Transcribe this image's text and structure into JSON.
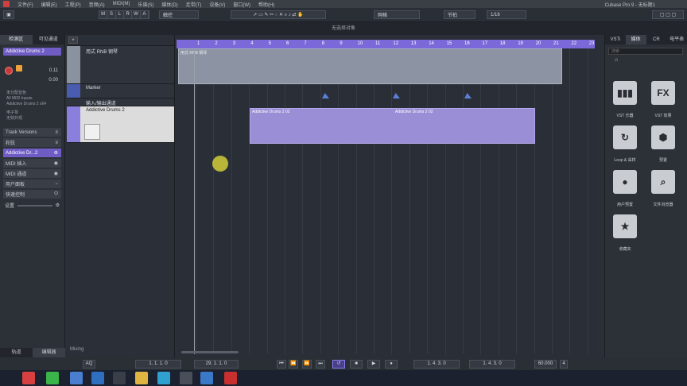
{
  "menubar": {
    "items": [
      "文件(F)",
      "编辑(E)",
      "工程(P)",
      "音频(A)",
      "MIDI(M)",
      "乐谱(S)",
      "媒体(D)",
      "走带(T)",
      "设备(V)",
      "窗口(W)",
      "帮助(H)"
    ],
    "app": "Cubase Pro 9 - 无标题1"
  },
  "toolbar": {
    "msrw": [
      "M",
      "S",
      "L",
      "R",
      "W",
      "A"
    ],
    "touch": "触控",
    "snap": "网格",
    "quantize": "节拍",
    "qvalue": "1/16"
  },
  "infobar": {
    "text": "无选择对象"
  },
  "inspector": {
    "tabs": [
      "检测区",
      "可见通道"
    ],
    "track_name": "Addictive Drums 2",
    "fields": [
      "未分配音色",
      "All MIDI Inputs",
      "Addictive Drums 2 x64"
    ],
    "sections": [
      "Track Versions",
      "和弦",
      "Addictive Dr...2",
      "MIDI 插入",
      "MIDI 通道",
      "用户面板",
      "快速控制"
    ],
    "setting_label": "设置",
    "volume": "0.11",
    "pan": "0.00",
    "midi_label": "电子琴",
    "midi_sub": "无效外观"
  },
  "tracklist": {
    "tracks": [
      "用式 RNB 钢琴",
      "Marker",
      "输入/输出通道",
      "Addictive Drums 2"
    ],
    "footer": "Mixing"
  },
  "project": {
    "ruler": [
      "1",
      "2",
      "3",
      "4",
      "5",
      "6",
      "7",
      "8",
      "9",
      "10",
      "11",
      "12",
      "13",
      "14",
      "15",
      "16",
      "17",
      "18",
      "19",
      "20",
      "21",
      "22",
      "23"
    ],
    "piano_label": "用式 RNB 钢琴",
    "drum_label_1": "Addictive Drums 2 02",
    "drum_label_2": "Addictive Drums 2 02"
  },
  "media": {
    "tabs": [
      "VSTi",
      "媒体",
      "CR",
      "电平表"
    ],
    "search_placeholder": "搜索",
    "tiles": [
      "VST 乐器",
      "VST 效果",
      "Loop & 采样",
      "预置",
      "用户预置",
      "文件浏览器",
      "收藏夹"
    ]
  },
  "bottom": {
    "left_tabs": [
      "轨道",
      "编辑器"
    ]
  },
  "transport": {
    "pos1": "1. 1. 1. 0",
    "pos2": "29. 1. 1. 0",
    "aq": "AQ",
    "left_loc": "1. 4. 3. 0",
    "right_loc": "1. 4. 3. 0",
    "tempo": "60.000",
    "sig": "4"
  }
}
